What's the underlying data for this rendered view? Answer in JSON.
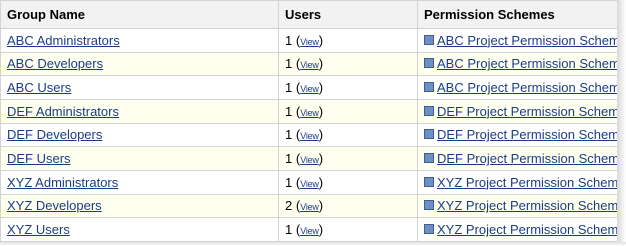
{
  "headers": {
    "group_name": "Group Name",
    "users": "Users",
    "permission_schemes": "Permission Schemes"
  },
  "view_label": "View",
  "rows": [
    {
      "group": "ABC Administrators",
      "users": "1",
      "scheme": "ABC Project Permission Scheme"
    },
    {
      "group": "ABC Developers",
      "users": "1",
      "scheme": "ABC Project Permission Scheme"
    },
    {
      "group": "ABC Users",
      "users": "1",
      "scheme": "ABC Project Permission Scheme"
    },
    {
      "group": "DEF Administrators",
      "users": "1",
      "scheme": "DEF Project Permission Scheme"
    },
    {
      "group": "DEF Developers",
      "users": "1",
      "scheme": "DEF Project Permission Scheme"
    },
    {
      "group": "DEF Users",
      "users": "1",
      "scheme": "DEF Project Permission Scheme"
    },
    {
      "group": "XYZ Administrators",
      "users": "1",
      "scheme": "XYZ Project Permission Scheme"
    },
    {
      "group": "XYZ Developers",
      "users": "2",
      "scheme": "XYZ Project Permission Scheme"
    },
    {
      "group": "XYZ Users",
      "users": "1",
      "scheme": "XYZ Project Permission Scheme"
    }
  ],
  "colors": {
    "link": "#1a3d86",
    "header_bg": "#f2f2f2",
    "alt_row_bg": "#fffff0",
    "border": "#d3d3d3"
  }
}
